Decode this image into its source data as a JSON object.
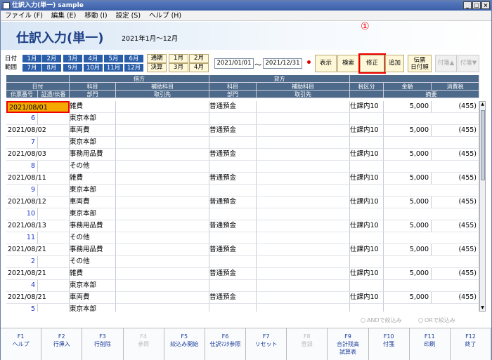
{
  "window": {
    "title": "仕訳入力(単一) sample",
    "min": "_",
    "max": "□",
    "close": "×"
  },
  "menu": [
    "ファイル (F)",
    "編集 (E)",
    "移動 (I)",
    "設定 (S)",
    "ヘルプ (H)"
  ],
  "page": {
    "title": "仕訳入力(単一)",
    "period": "2021年1月～12月",
    "marker": "①"
  },
  "date_range": {
    "label1": "日付",
    "label2": "範囲",
    "months_row1": [
      "1月",
      "2月",
      "3月",
      "4月",
      "5月",
      "6月"
    ],
    "months_row2": [
      "7月",
      "8月",
      "9月",
      "10月",
      "11月",
      "12月"
    ],
    "quarter": [
      "通期",
      "決算"
    ],
    "extra_row1": [
      "1月",
      "2月"
    ],
    "extra_row2": [
      "3月",
      "4月"
    ],
    "from": "2021/01/01",
    "tilde": "～",
    "to": "2021/12/31"
  },
  "buttons": {
    "show": "表示",
    "search": "検索",
    "modify": "修正",
    "add": "追加",
    "voucher1": "伝票",
    "voucher2": "日付順",
    "tagup": "付箋▲",
    "tagdown": "付箋▼"
  },
  "headers": {
    "debit": "借方",
    "credit": "貸方",
    "date": "日付",
    "voucher_no": "伝票番号",
    "cert": "証憑/伝番",
    "account": "科目",
    "sub_account": "補助科目",
    "dept": "部門",
    "partner": "取引先",
    "tax_class": "税区分",
    "amount": "金額",
    "summary": "摘要",
    "tax": "消費税"
  },
  "rows": [
    {
      "date": "2021/08/01",
      "no": "6",
      "debit": "雑費",
      "dept": "東京本部",
      "credit": "普通預金",
      "tax_class": "仕課内10",
      "amount": "5,000",
      "tax": "(455)"
    },
    {
      "date": "2021/08/02",
      "no": "7",
      "debit": "車両費",
      "dept": "東京本部",
      "credit": "普通預金",
      "tax_class": "仕課内10",
      "amount": "5,000",
      "tax": "(455)"
    },
    {
      "date": "2021/08/03",
      "no": "8",
      "debit": "事務用品費",
      "dept": "その他",
      "credit": "普通預金",
      "tax_class": "仕課内10",
      "amount": "5,000",
      "tax": "(455)"
    },
    {
      "date": "2021/08/11",
      "no": "9",
      "debit": "雑費",
      "dept": "東京本部",
      "credit": "普通預金",
      "tax_class": "仕課内10",
      "amount": "5,000",
      "tax": "(455)"
    },
    {
      "date": "2021/08/12",
      "no": "10",
      "debit": "車両費",
      "dept": "東京本部",
      "credit": "普通預金",
      "tax_class": "仕課内10",
      "amount": "5,000",
      "tax": "(455)"
    },
    {
      "date": "2021/08/13",
      "no": "11",
      "debit": "事務用品費",
      "dept": "その他",
      "credit": "普通預金",
      "tax_class": "仕課内10",
      "amount": "5,000",
      "tax": "(455)"
    },
    {
      "date": "2021/08/21",
      "no": "2",
      "debit": "事務用品費",
      "dept": "その他",
      "credit": "普通預金",
      "tax_class": "仕課内10",
      "amount": "5,000",
      "tax": "(455)"
    },
    {
      "date": "2021/08/21",
      "no": "4",
      "debit": "雑費",
      "dept": "東京本部",
      "credit": "普通預金",
      "tax_class": "仕課内10",
      "amount": "5,000",
      "tax": "(455)"
    },
    {
      "date": "2021/08/21",
      "no": "5",
      "debit": "車両費",
      "dept": "東京本部",
      "credit": "普通預金",
      "tax_class": "仕課内10",
      "amount": "5,000",
      "tax": "(455)"
    }
  ],
  "filters": {
    "and": "ANDで絞込み",
    "or": "ORで絞込み"
  },
  "fkeys": [
    {
      "k": "F1",
      "l": "ヘルプ",
      "l2": ""
    },
    {
      "k": "F2",
      "l": "行挿入",
      "l2": ""
    },
    {
      "k": "F3",
      "l": "行削除",
      "l2": ""
    },
    {
      "k": "F4",
      "l": "参照",
      "l2": ""
    },
    {
      "k": "F5",
      "l": "絞込み開始",
      "l2": ""
    },
    {
      "k": "F6",
      "l": "仕訳ﾏｽﾀ参照",
      "l2": ""
    },
    {
      "k": "F7",
      "l": "リセット",
      "l2": ""
    },
    {
      "k": "F8",
      "l": "登録",
      "l2": ""
    },
    {
      "k": "F9",
      "l": "合計残高",
      "l2": "試算表"
    },
    {
      "k": "F10",
      "l": "付箋",
      "l2": ""
    },
    {
      "k": "F11",
      "l": "印刷",
      "l2": ""
    },
    {
      "k": "F12",
      "l": "終了",
      "l2": ""
    }
  ]
}
